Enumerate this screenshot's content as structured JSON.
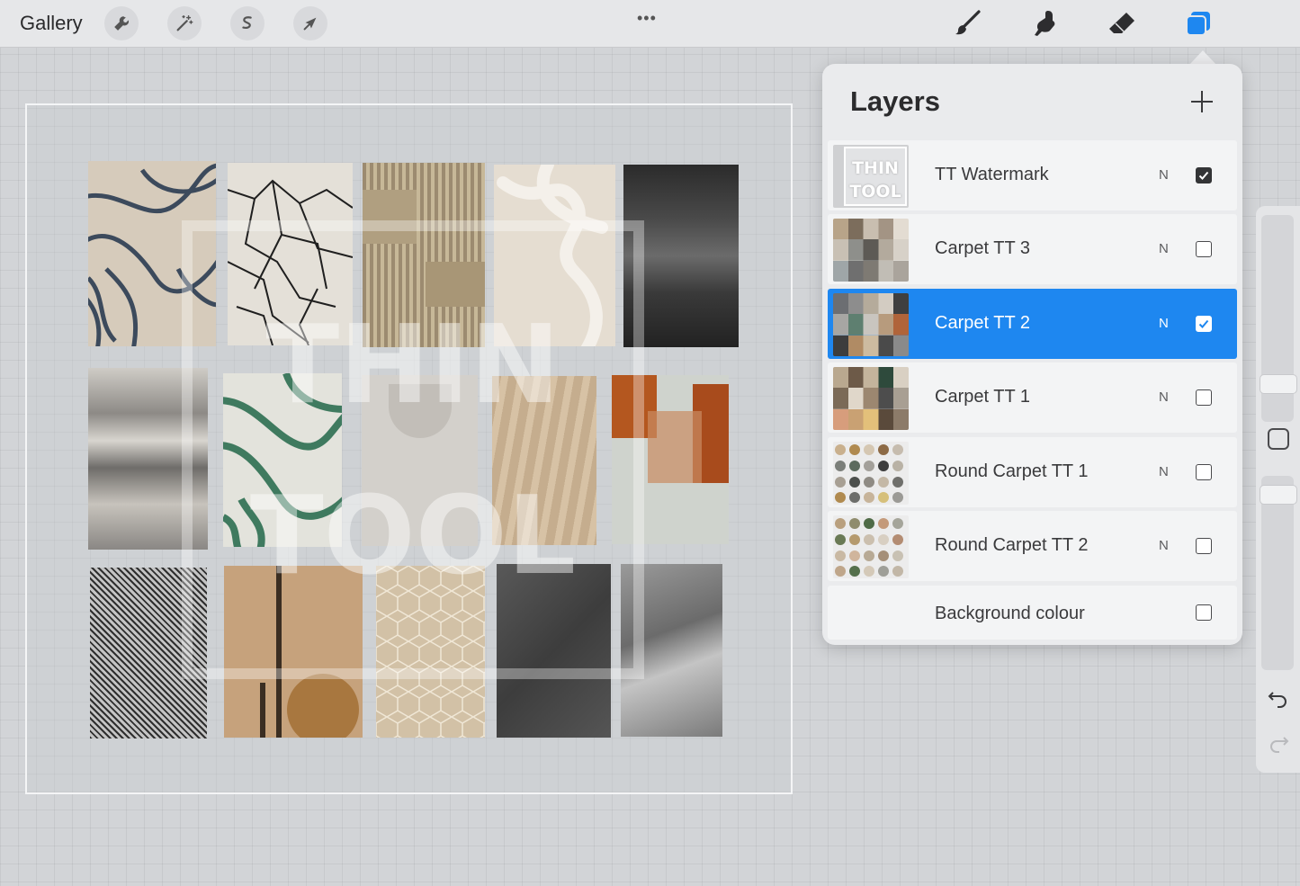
{
  "topbar": {
    "gallery_label": "Gallery",
    "menu_dots": "•••",
    "left_tools": [
      "wrench-icon",
      "magic-wand-icon",
      "selection-icon",
      "transform-arrow-icon"
    ],
    "right_tools": [
      "brush-icon",
      "smudge-icon",
      "eraser-icon",
      "layers-icon"
    ],
    "accent_color": "#1e87f0"
  },
  "watermark": {
    "line1": "THIN",
    "line2": "TOOL"
  },
  "layers_panel": {
    "title": "Layers",
    "add_icon": "plus-icon",
    "layers": [
      {
        "name": "TT Watermark",
        "blend": "N",
        "visible": true,
        "selected": false,
        "thumb_text": [
          "THIN",
          "TOOL"
        ]
      },
      {
        "name": "Carpet TT 3",
        "blend": "N",
        "visible": false,
        "selected": false
      },
      {
        "name": "Carpet TT 2",
        "blend": "N",
        "visible": true,
        "selected": true
      },
      {
        "name": "Carpet TT 1",
        "blend": "N",
        "visible": false,
        "selected": false
      },
      {
        "name": "Round Carpet TT 1",
        "blend": "N",
        "visible": false,
        "selected": false
      },
      {
        "name": "Round Carpet TT 2",
        "blend": "N",
        "visible": false,
        "selected": false
      },
      {
        "name": "Background colour",
        "blend": "",
        "visible": false,
        "selected": false
      }
    ]
  },
  "sidebar": {
    "icons": [
      "modifier-square-icon",
      "undo-icon",
      "redo-icon"
    ]
  }
}
